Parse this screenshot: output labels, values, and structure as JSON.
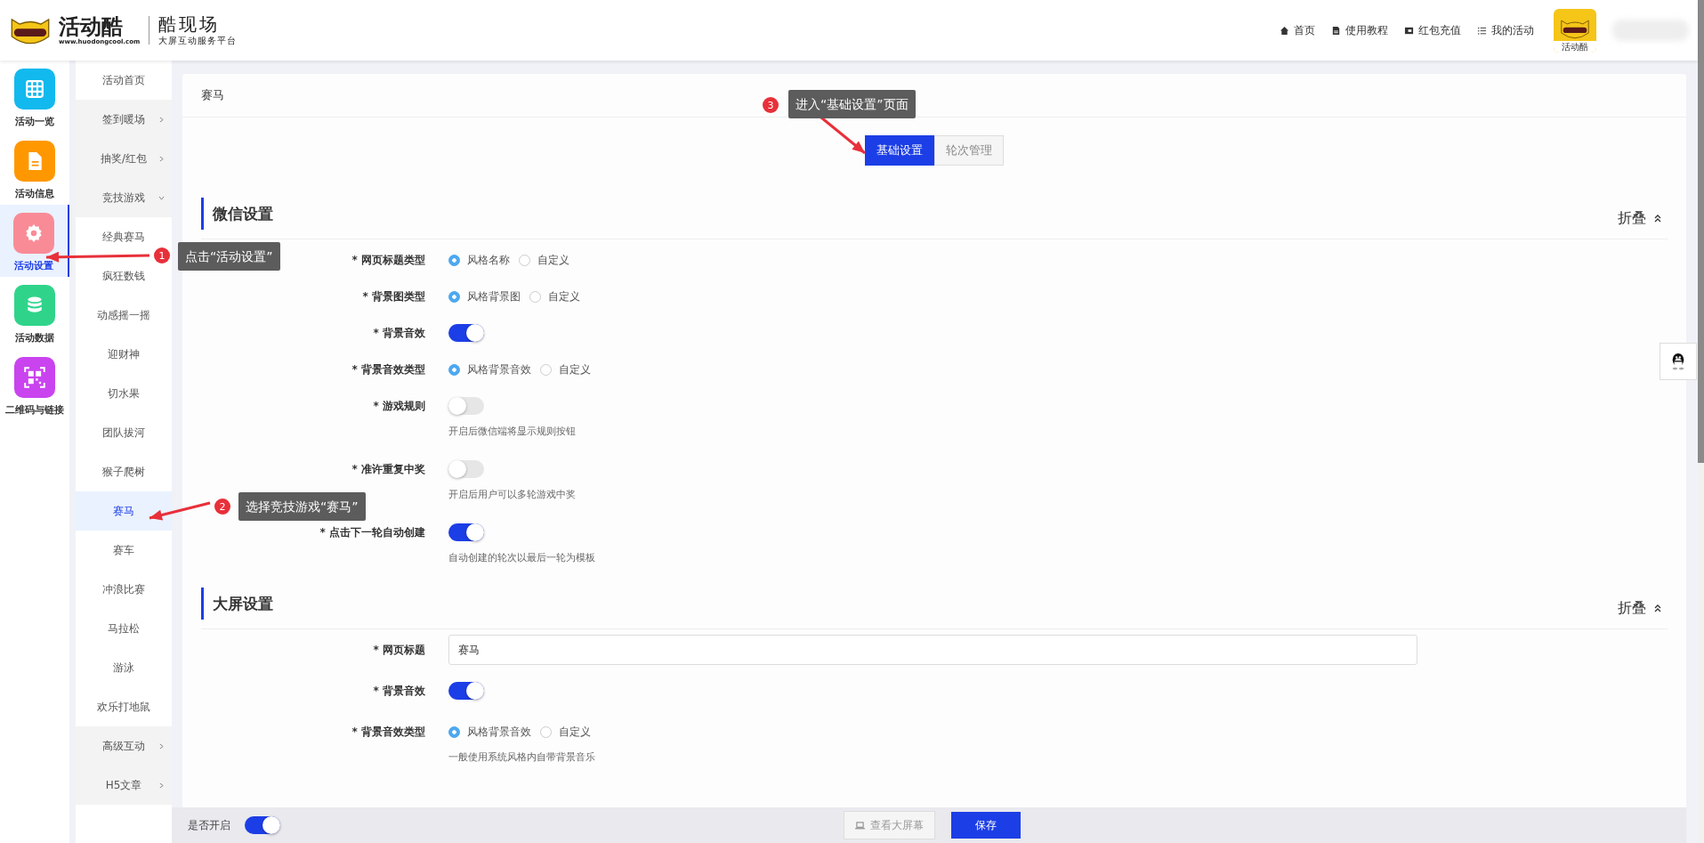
{
  "header": {
    "logo": {
      "brand": "活动酷",
      "site": "www.huodongcool.com",
      "product": "酷现场",
      "tagline": "大屏互动服务平台"
    },
    "nav": [
      {
        "label": "首页",
        "kind": "home"
      },
      {
        "label": "使用教程",
        "kind": "doc"
      },
      {
        "label": "红包充值",
        "kind": "wallet"
      },
      {
        "label": "我的活动",
        "kind": "list"
      }
    ],
    "avatar": {
      "caption": "活动酷"
    }
  },
  "rail": [
    {
      "label": "活动一览",
      "kind": "grid",
      "color": "#12b9ee",
      "selected": false
    },
    {
      "label": "活动信息",
      "kind": "doc",
      "color": "#ff9800",
      "selected": false
    },
    {
      "label": "活动设置",
      "kind": "gear",
      "color": "#f98b97",
      "selected": true
    },
    {
      "label": "活动数据",
      "kind": "database",
      "color": "#2fd48a",
      "selected": false
    },
    {
      "label": "二维码与链接",
      "kind": "qr",
      "color": "#c944ef",
      "selected": false
    }
  ],
  "submenu": [
    {
      "label": "活动首页",
      "kind": "link",
      "selected": false
    },
    {
      "label": "签到暖场",
      "kind": "group",
      "expanded": false,
      "selected": false
    },
    {
      "label": "抽奖/红包",
      "kind": "group",
      "expanded": false,
      "selected": false
    },
    {
      "label": "竞技游戏",
      "kind": "group",
      "expanded": true,
      "selected": false,
      "children": [
        {
          "label": "经典赛马",
          "selected": false
        },
        {
          "label": "疯狂数钱",
          "selected": false
        },
        {
          "label": "动感摇一摇",
          "selected": false
        },
        {
          "label": "迎财神",
          "selected": false
        },
        {
          "label": "切水果",
          "selected": false
        },
        {
          "label": "团队拔河",
          "selected": false
        },
        {
          "label": "猴子爬树",
          "selected": false
        },
        {
          "label": "赛马",
          "selected": true
        },
        {
          "label": "赛车",
          "selected": false
        },
        {
          "label": "冲浪比赛",
          "selected": false
        },
        {
          "label": "马拉松",
          "selected": false
        },
        {
          "label": "游泳",
          "selected": false
        },
        {
          "label": "欢乐打地鼠",
          "selected": false
        }
      ]
    },
    {
      "label": "高级互动",
      "kind": "group",
      "expanded": false,
      "selected": false
    },
    {
      "label": "H5文章",
      "kind": "group",
      "expanded": false,
      "selected": false
    }
  ],
  "page": {
    "title": "赛马",
    "tabs": [
      {
        "label": "基础设置",
        "selected": true
      },
      {
        "label": "轮次管理",
        "selected": false
      }
    ],
    "sections": [
      {
        "title": "微信设置",
        "collapse": "折叠",
        "fields": [
          {
            "kind": "radio",
            "label": "* 网页标题类型",
            "options": [
              {
                "label": "风格名称",
                "selected": true
              },
              {
                "label": "自定义",
                "selected": false
              }
            ]
          },
          {
            "kind": "radio",
            "label": "* 背景图类型",
            "options": [
              {
                "label": "风格背景图",
                "selected": true
              },
              {
                "label": "自定义",
                "selected": false
              }
            ]
          },
          {
            "kind": "switch",
            "label": "* 背景音效",
            "on": true
          },
          {
            "kind": "radio",
            "label": "* 背景音效类型",
            "options": [
              {
                "label": "风格背景音效",
                "selected": true
              },
              {
                "label": "自定义",
                "selected": false
              }
            ]
          },
          {
            "kind": "switch",
            "label": "* 游戏规则",
            "on": false,
            "hint": "开启后微信端将显示规则按钮"
          },
          {
            "kind": "switch",
            "label": "* 准许重复中奖",
            "on": false,
            "hint": "开启后用户可以多轮游戏中奖"
          },
          {
            "kind": "switch",
            "label": "* 点击下一轮自动创建",
            "on": true,
            "hint": "自动创建的轮次以最后一轮为模板"
          }
        ]
      },
      {
        "title": "大屏设置",
        "collapse": "折叠",
        "fields": [
          {
            "kind": "input",
            "label": "* 网页标题",
            "value": "赛马"
          },
          {
            "kind": "switch",
            "label": "* 背景音效",
            "on": true
          },
          {
            "kind": "radio",
            "label": "* 背景音效类型",
            "options": [
              {
                "label": "风格背景音效",
                "selected": true
              },
              {
                "label": "自定义",
                "selected": false
              }
            ],
            "hint": "一般使用系统风格内自带背景音乐"
          }
        ]
      }
    ]
  },
  "footer": {
    "enable": {
      "label": "是否开启",
      "on": true
    },
    "preview": {
      "label": "查看大屏幕",
      "disabled": true
    },
    "save": {
      "label": "保存"
    }
  },
  "annotations": [
    {
      "number": "1",
      "text": "点击“活动设置”"
    },
    {
      "number": "2",
      "text": "选择竞技游戏“赛马”"
    },
    {
      "number": "3",
      "text": "进入“基础设置”页面"
    }
  ]
}
